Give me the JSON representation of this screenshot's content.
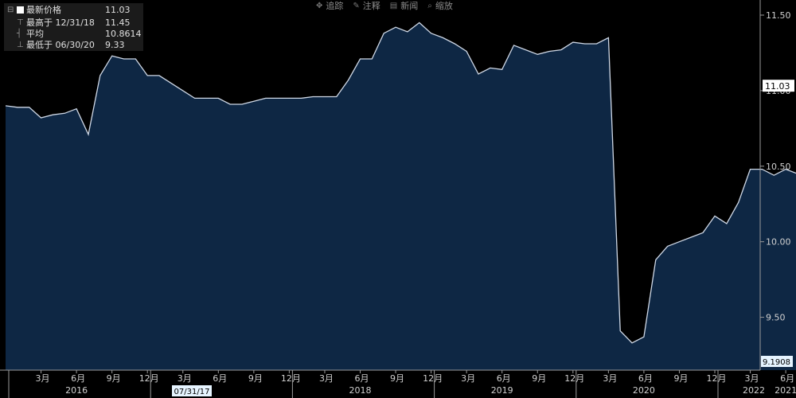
{
  "toolbar": {
    "track": {
      "label": "追踪",
      "icon": "crosshair-icon"
    },
    "annotate": {
      "label": "注释",
      "icon": "pencil-icon"
    },
    "news": {
      "label": "新闻",
      "icon": "news-icon"
    },
    "zoom": {
      "label": "缩放",
      "icon": "magnifier-icon"
    }
  },
  "legend": {
    "last": {
      "label": "最新价格",
      "value": "11.03"
    },
    "high": {
      "label": "最高于 12/31/18",
      "value": "11.45"
    },
    "avg": {
      "label": "平均",
      "value": "10.8614"
    },
    "low": {
      "label": "最低于 06/30/20",
      "value": "9.33"
    }
  },
  "colors": {
    "background": "#000000",
    "area": "#0e2744",
    "line": "#cfd8e6",
    "last_badge": "#ffffff",
    "min_badge": "#e6f4ff"
  },
  "chart_data": {
    "type": "area",
    "x_start": "2015-12-31",
    "x_step": "month",
    "values": [
      10.9,
      10.89,
      10.89,
      10.82,
      10.84,
      10.85,
      10.88,
      10.71,
      11.1,
      11.23,
      11.21,
      11.21,
      11.1,
      11.1,
      11.05,
      11.0,
      10.95,
      10.95,
      10.95,
      10.91,
      10.91,
      10.93,
      10.95,
      10.95,
      10.95,
      10.95,
      10.96,
      10.96,
      10.96,
      11.07,
      11.21,
      11.21,
      11.38,
      11.42,
      11.39,
      11.45,
      11.38,
      11.35,
      11.31,
      11.26,
      11.11,
      11.15,
      11.14,
      11.3,
      11.27,
      11.24,
      11.26,
      11.27,
      11.32,
      11.31,
      11.31,
      11.35,
      9.41,
      9.33,
      9.37,
      9.88,
      9.97,
      10.0,
      10.03,
      10.06,
      10.17,
      10.12,
      10.26,
      10.48,
      10.48,
      10.44,
      10.48,
      10.45,
      10.75,
      10.86,
      10.91,
      10.92,
      11.03
    ],
    "ylim": [
      9.15,
      11.6
    ],
    "y_ticks": [
      "11.50",
      "11.00",
      "10.50",
      "10.00",
      "9.50"
    ],
    "x_month_labels": [
      "3月",
      "6月",
      "9月",
      "12月",
      "3月",
      "6月",
      "9月",
      "12月",
      "3月",
      "6月",
      "9月",
      "12月",
      "3月",
      "6月",
      "9月",
      "12月",
      "3月",
      "6月",
      "9月",
      "12月",
      "3月",
      "6月",
      "9月",
      "12月"
    ],
    "x_year_labels": [
      "2016",
      "2018",
      "2019",
      "2020",
      "2021",
      "2022"
    ],
    "cursor_date_label": "07/31/17",
    "last_value_label": "11.03",
    "min_value_label": "9.1908",
    "grid": false
  }
}
